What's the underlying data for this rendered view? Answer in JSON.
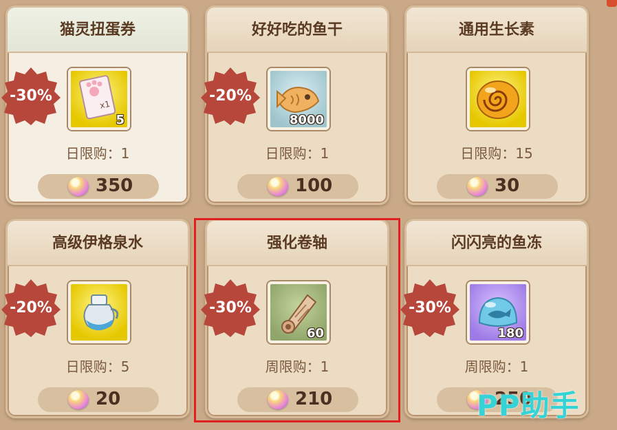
{
  "items": [
    {
      "title": "猫灵扭蛋券",
      "discount": "-30%",
      "qty": "5",
      "limit": "日限购：1",
      "price": "350",
      "icon": "paw-ticket-icon",
      "bg": "yellow"
    },
    {
      "title": "好好吃的鱼干",
      "discount": "-20%",
      "qty": "8000",
      "limit": "日限购：1",
      "price": "100",
      "icon": "fish-cracker-icon",
      "bg": "blue"
    },
    {
      "title": "通用生长素",
      "discount": "",
      "qty": "",
      "limit": "日限购：15",
      "price": "30",
      "icon": "growth-orb-icon",
      "bg": "yellow"
    },
    {
      "title": "高级伊格泉水",
      "discount": "-20%",
      "qty": "",
      "limit": "日限购：5",
      "price": "20",
      "icon": "spring-water-jar-icon",
      "bg": "yellow"
    },
    {
      "title": "强化卷轴",
      "discount": "-30%",
      "qty": "60",
      "limit": "周限购：1",
      "price": "210",
      "icon": "scroll-icon",
      "bg": "green"
    },
    {
      "title": "闪闪亮的鱼冻",
      "discount": "-30%",
      "qty": "180",
      "limit": "周限购：1",
      "price": "250",
      "icon": "fish-jelly-icon",
      "bg": "purple"
    }
  ],
  "watermark": "PP助手"
}
